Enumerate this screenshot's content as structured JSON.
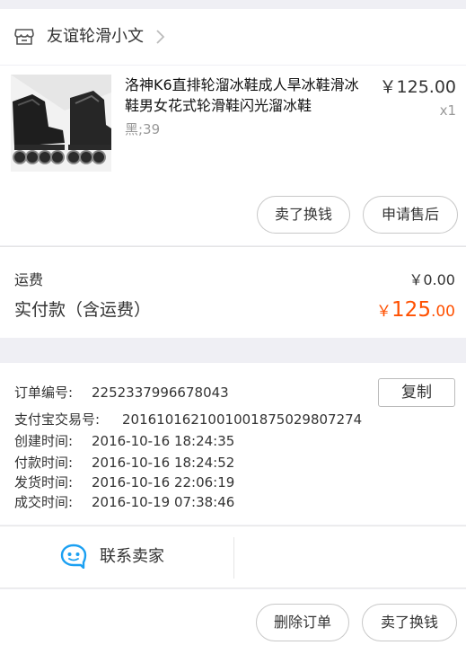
{
  "shop": {
    "name": "友谊轮滑小文",
    "icon": "store-icon"
  },
  "product": {
    "title": "洛神K6直排轮溜冰鞋成人旱冰鞋滑冰鞋男女花式轮滑鞋闪光溜冰鞋",
    "variant": "黑;39",
    "price": "￥125.00",
    "quantity": "x1",
    "image": "roller-skates-image",
    "sell_label": "卖了换钱",
    "aftersale_label": "申请售后"
  },
  "summary": {
    "shipping_label": "运费",
    "shipping_value": "￥0.00",
    "paid_label": "实付款（含运费）",
    "paid_currency": "￥",
    "paid_integer": "125",
    "paid_decimal": ".00",
    "paid_color": "#ff5000"
  },
  "order_info": {
    "order_number_label": "订单编号:",
    "order_number": "2252337996678043",
    "copy_label": "复制",
    "alipay_label": "支付宝交易号:",
    "alipay_number": "2016101621001001875029807274",
    "created_label": "创建时间:",
    "created_time": "2016-10-16 18:24:35",
    "paid_label": "付款时间:",
    "paid_time": "2016-10-16 18:24:52",
    "shipped_label": "发货时间:",
    "shipped_time": "2016-10-16 22:06:19",
    "completed_label": "成交时间:",
    "completed_time": "2016-10-19 07:38:46"
  },
  "contact": {
    "label": "联系卖家",
    "icon": "chat-bubble-icon",
    "icon_color": "#1ba0f2"
  },
  "bottom_bar": {
    "delete_label": "删除订单",
    "sell_label": "卖了换钱"
  }
}
